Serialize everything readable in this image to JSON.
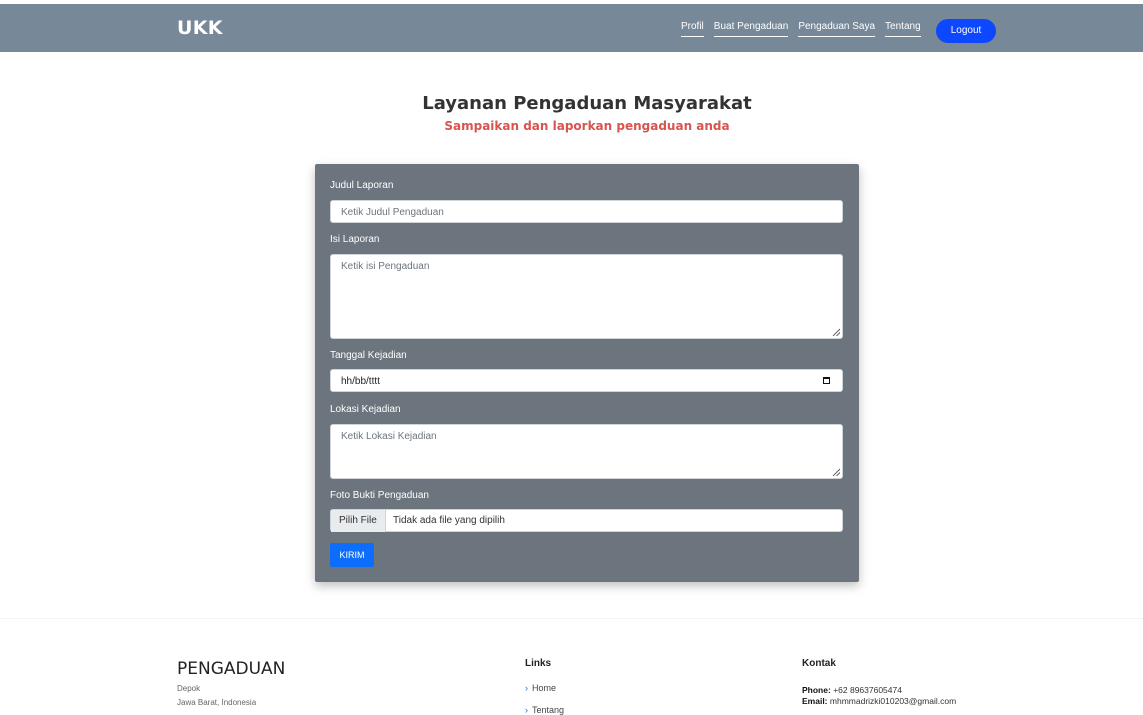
{
  "navbar": {
    "brand": "UKK",
    "links": [
      "Profil",
      "Buat Pengaduan",
      "Pengaduan Saya",
      "Tentang"
    ],
    "logout_label": "Logout"
  },
  "hero": {
    "title": "Layanan Pengaduan Masyarakat",
    "subtitle": "Sampaikan dan laporkan pengaduan anda"
  },
  "form": {
    "judul_label": "Judul Laporan",
    "judul_placeholder": "Ketik Judul Pengaduan",
    "isi_label": "Isi Laporan",
    "isi_placeholder": "Ketik isi Pengaduan",
    "tanggal_label": "Tanggal Kejadian",
    "tanggal_value": "hh/bb/tttt",
    "lokasi_label": "Lokasi Kejadian",
    "lokasi_placeholder": "Ketik Lokasi Kejadian",
    "foto_label": "Foto Bukti Pengaduan",
    "file_button": "Pilih File",
    "file_text": "Tidak ada file yang dipilih",
    "submit_label": "KIRIM"
  },
  "footer": {
    "brand": "PENGADUAN",
    "address_line1": "Depok",
    "address_line2": "Jawa Barat, Indonesia",
    "links_heading": "Links",
    "links": [
      "Home",
      "Tentang"
    ],
    "contact_heading": "Kontak",
    "phone_label": "Phone:",
    "phone_value": "+62 89637605474",
    "email_label": "Email:",
    "email_value": "mhmmadrizki010203@gmail.com"
  },
  "colors": {
    "navbar": "#778899",
    "accent": "#0d6efd",
    "subtitle": "#d9534f",
    "card": "#6c757d"
  }
}
